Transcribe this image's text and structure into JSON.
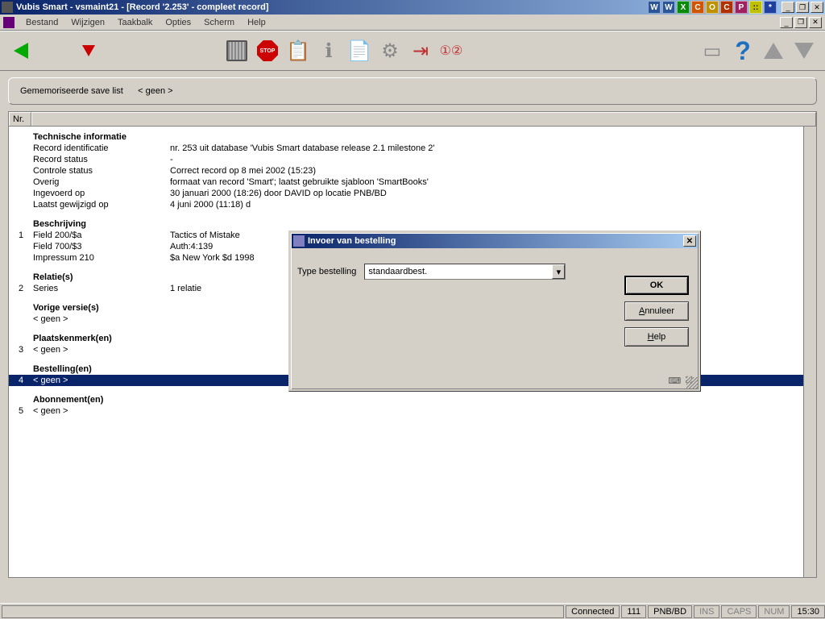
{
  "titlebar": {
    "text": "Vubis Smart - vsmaint21 - [Record '2.253' - compleet record]"
  },
  "tray": [
    "W",
    "W",
    "X",
    "C",
    "O",
    "C",
    "P",
    "::",
    "*"
  ],
  "menus": [
    "Bestand",
    "Wijzigen",
    "Taakbalk",
    "Opties",
    "Scherm",
    "Help"
  ],
  "infobar": {
    "label": "Gememoriseerde save list",
    "value": "< geen >"
  },
  "gridHeader": {
    "nr": "Nr."
  },
  "sections": {
    "tech": {
      "title": "Technische informatie",
      "rows": [
        {
          "label": "Record identificatie",
          "val": "nr. 253 uit database 'Vubis Smart database    release 2.1 milestone 2'"
        },
        {
          "label": "Record status",
          "val": "-"
        },
        {
          "label": "Controle status",
          "val": "Correct record op 8 mei 2002 (15:23)"
        },
        {
          "label": "Overig",
          "val": "formaat van record 'Smart'; laatst gebruikte sjabloon 'SmartBooks'"
        },
        {
          "label": "Ingevoerd op",
          "val": "30 januari 2000 (18:26) door DAVID op locatie PNB/BD"
        },
        {
          "label": "Laatst gewijzigd op",
          "val": "4 juni 2000 (11:18) d"
        }
      ]
    },
    "beschr": {
      "title": "Beschrijving",
      "num": "1",
      "rows": [
        {
          "label": "Field 200/$a",
          "val": "Tactics of Mistake"
        },
        {
          "label": "Field 700/$3",
          "val": "Auth:4:139"
        },
        {
          "label": "Impressum 210",
          "val": "$a New York $d 1998"
        }
      ]
    },
    "rel": {
      "title": "Relatie(s)",
      "num": "2",
      "rows": [
        {
          "label": "Series",
          "val": "1 relatie"
        }
      ]
    },
    "vorige": {
      "title": "Vorige versie(s)",
      "geen": "< geen >"
    },
    "plaats": {
      "title": "Plaatskenmerk(en)",
      "num": "3",
      "geen": "< geen >"
    },
    "best": {
      "title": "Bestelling(en)",
      "num": "4",
      "geen": "< geen >"
    },
    "abon": {
      "title": "Abonnement(en)",
      "num": "5",
      "geen": "< geen >"
    }
  },
  "dialog": {
    "title": "Invoer van bestelling",
    "label": "Type bestelling",
    "selectValue": "standaardbest.",
    "ok": "OK",
    "annuleer": "Annuleer",
    "help": "Help"
  },
  "statusbar": {
    "connected": "Connected",
    "num": "111",
    "location": "PNB/BD",
    "ins": "INS",
    "caps": "CAPS",
    "numlock": "NUM",
    "time": "15:30"
  }
}
